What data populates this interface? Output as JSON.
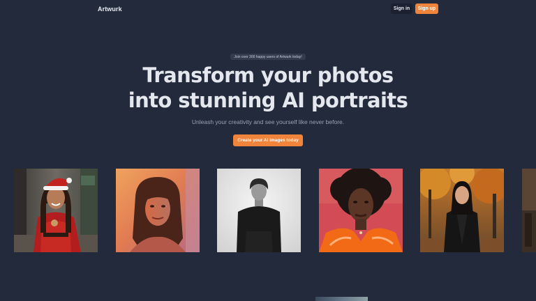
{
  "nav": {
    "logo": "Artwurk",
    "signin_label": "Sign in",
    "signup_label": "Sign up"
  },
  "hero": {
    "badge": "Join over 300 happy users of Artwurk today!",
    "headline_line1": "Transform your photos",
    "headline_line2": "into stunning AI portraits",
    "subtitle": "Unleash your creativity and see yourself like never before.",
    "cta_label": "Create your AI images today"
  },
  "colors": {
    "background": "#232a3b",
    "accent": "#f0843a",
    "headline": "#e4e7ee",
    "subtitle": "#9aa2b4"
  },
  "gallery": {
    "images": [
      "woman-in-red-santa-outfit",
      "woman-in-orange-light",
      "man-black-and-white",
      "woman-orange-jacket",
      "woman-autumn-park",
      "partial-image"
    ]
  }
}
